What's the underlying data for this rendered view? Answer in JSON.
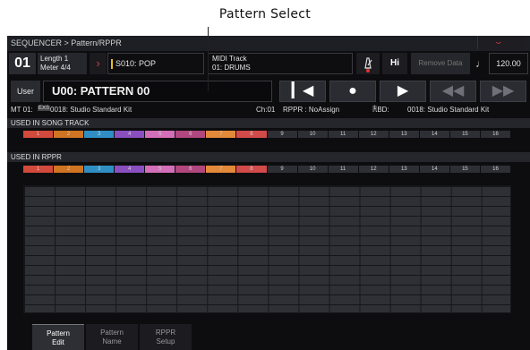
{
  "annotation": {
    "label": "Pattern Select"
  },
  "titlebar": {
    "title": "SEQUENCER > Pattern/RPPR",
    "menu_icon": "chevron-down-icon"
  },
  "track": {
    "number": "01",
    "length": "Length 1",
    "meter": "Meter 4/4",
    "song": "S010: POP",
    "midi_track": "MIDI Track",
    "midi_name": "01: DRUMS",
    "metronome_icon": "metronome-icon",
    "hi": "Hi",
    "remove_data": "Remove Data",
    "tempo_icon": "quarter-note-icon",
    "tempo": "120.00"
  },
  "pattern": {
    "bank_button": "User",
    "name": "U00: PATTERN 00"
  },
  "transport": {
    "to_start": "⏮",
    "record": "⏺",
    "play": "▶",
    "rewind": "◀◀",
    "fast_forward": "▶▶"
  },
  "info": {
    "mt": "MT 01:",
    "exs": "EXS",
    "program": "0018: Studio Standard Kit",
    "ch": "Ch:01",
    "rppr": "RPPR : NoAssign",
    "kbd": "KBD:",
    "kbd_num": "1",
    "kbd_program": "0018: Studio Standard Kit"
  },
  "sections": {
    "song_track": "USED IN SONG TRACK",
    "rppr": "USED IN RPPR"
  },
  "tracks": [
    {
      "label": "1",
      "color": "#d24a3c"
    },
    {
      "label": "2",
      "color": "#cf7422"
    },
    {
      "label": "3",
      "color": "#2f8fc4"
    },
    {
      "label": "4",
      "color": "#8a4fbf"
    },
    {
      "label": "5",
      "color": "#d36fb8"
    },
    {
      "label": "6",
      "color": "#b0477e"
    },
    {
      "label": "7",
      "color": "#e3893a"
    },
    {
      "label": "8",
      "color": "#d24a4a"
    },
    {
      "label": "9",
      "color": "#2e2f35"
    },
    {
      "label": "10",
      "color": "#2e2f35"
    },
    {
      "label": "11",
      "color": "#2e2f35"
    },
    {
      "label": "12",
      "color": "#2e2f35"
    },
    {
      "label": "13",
      "color": "#2e2f35"
    },
    {
      "label": "14",
      "color": "#2e2f35"
    },
    {
      "label": "15",
      "color": "#2e2f35"
    },
    {
      "label": "16",
      "color": "#2e2f35"
    }
  ],
  "tabs": [
    {
      "line1": "Pattern",
      "line2": "Edit",
      "active": true
    },
    {
      "line1": "Pattern",
      "line2": "Name",
      "active": false
    },
    {
      "line1": "RPPR",
      "line2": "Setup",
      "active": false
    }
  ]
}
